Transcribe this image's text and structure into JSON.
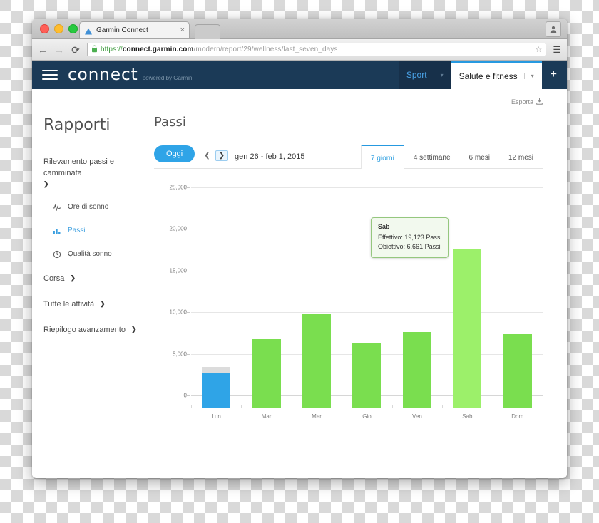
{
  "browser": {
    "tab": {
      "title": "Garmin Connect",
      "close_label": "×",
      "favicon": "garmin-triangle-icon"
    },
    "new_tab_label": "",
    "profile_icon": "user-avatar-icon",
    "nav": {
      "back": "←",
      "forward": "→",
      "reload": "⟳"
    },
    "url": {
      "scheme": "https://",
      "host": "connect.garmin.com",
      "path": "/modern/report/29/wellness/last_seven_days",
      "lock_icon": "padlock-icon"
    },
    "star_icon": "☆",
    "menu_icon": "hamburger-menu-icon"
  },
  "app": {
    "brand": {
      "name": "connect",
      "tagline": "powered by Garmin"
    },
    "menu_icon": "hamburger-menu-icon",
    "nav_tabs": [
      {
        "label": "Sport",
        "active": false,
        "caret": "▾"
      },
      {
        "label": "Salute e fitness",
        "active": true,
        "caret": "▾"
      }
    ],
    "add_button": "+",
    "export": {
      "label": "Esporta",
      "icon": "export-download-icon"
    }
  },
  "sidebar": {
    "page_title": "Rapporti",
    "groups": [
      {
        "label": "Rilevamento passi e camminata",
        "chevron": "❯"
      }
    ],
    "sub_items": [
      {
        "label": "Ore di sonno",
        "icon": "pulse-wave-icon",
        "active": false
      },
      {
        "label": "Passi",
        "icon": "bar-chart-icon",
        "active": true
      },
      {
        "label": "Qualità sonno",
        "icon": "clock-icon",
        "active": false
      }
    ],
    "groups_bottom": [
      {
        "label": "Corsa",
        "chevron": "❯"
      },
      {
        "label": "Tutte le attività",
        "chevron": "❯"
      },
      {
        "label": "Riepilogo avanzamento",
        "chevron": "❯"
      }
    ]
  },
  "report": {
    "title": "Passi",
    "today_button": "Oggi",
    "prev_arrow": "❮",
    "next_arrow": "❯",
    "date_range": "gen 26 - feb 1, 2015",
    "range_tabs": [
      {
        "label": "7 giorni",
        "active": true
      },
      {
        "label": "4 settimane",
        "active": false
      },
      {
        "label": "6 mesi",
        "active": false
      },
      {
        "label": "12 mesi",
        "active": false
      }
    ],
    "tooltip": {
      "day": "Sab",
      "actual_label": "Effettivo:",
      "actual_value": "19,123 Passi",
      "goal_label": "Obiettivo:",
      "goal_value": "6,661 Passi"
    }
  },
  "colors": {
    "brand_navy": "#1b3a57",
    "accent_blue": "#2fa4e7",
    "bar_green": "#7ade4f",
    "bar_green_highlight": "#9cf06a",
    "bar_blue": "#2fa4e7",
    "goal_gray": "#dcdcdc"
  },
  "chart_data": {
    "type": "bar",
    "title": "Passi",
    "xlabel": "",
    "ylabel": "",
    "ylim": [
      0,
      25000
    ],
    "yticks": [
      0,
      5000,
      10000,
      15000,
      20000,
      25000
    ],
    "ytick_labels": [
      "0",
      "5,000",
      "10,000",
      "15,000",
      "20,000",
      "25,000"
    ],
    "grid": true,
    "legend": "none",
    "categories": [
      "Lun",
      "Mar",
      "Mer",
      "Gio",
      "Ven",
      "Sab",
      "Dom"
    ],
    "series": [
      {
        "name": "Passi",
        "values": [
          4200,
          8300,
          11300,
          7800,
          9200,
          19123,
          8900
        ],
        "bar_colors": [
          "#2fa4e7",
          "#7ade4f",
          "#7ade4f",
          "#7ade4f",
          "#7ade4f",
          "#9cf06a",
          "#7ade4f"
        ]
      },
      {
        "name": "Obiettivo",
        "values": [
          5000,
          null,
          null,
          null,
          null,
          6661,
          null
        ],
        "note": "goal cap shown as gray segment above the blue bar on Lun"
      }
    ],
    "annotations": [
      {
        "category": "Sab",
        "day": "Sab",
        "actual": 19123,
        "goal": 6661,
        "text": "Sab / Effettivo: 19,123 Passi / Obiettivo: 6,661 Passi"
      }
    ]
  }
}
